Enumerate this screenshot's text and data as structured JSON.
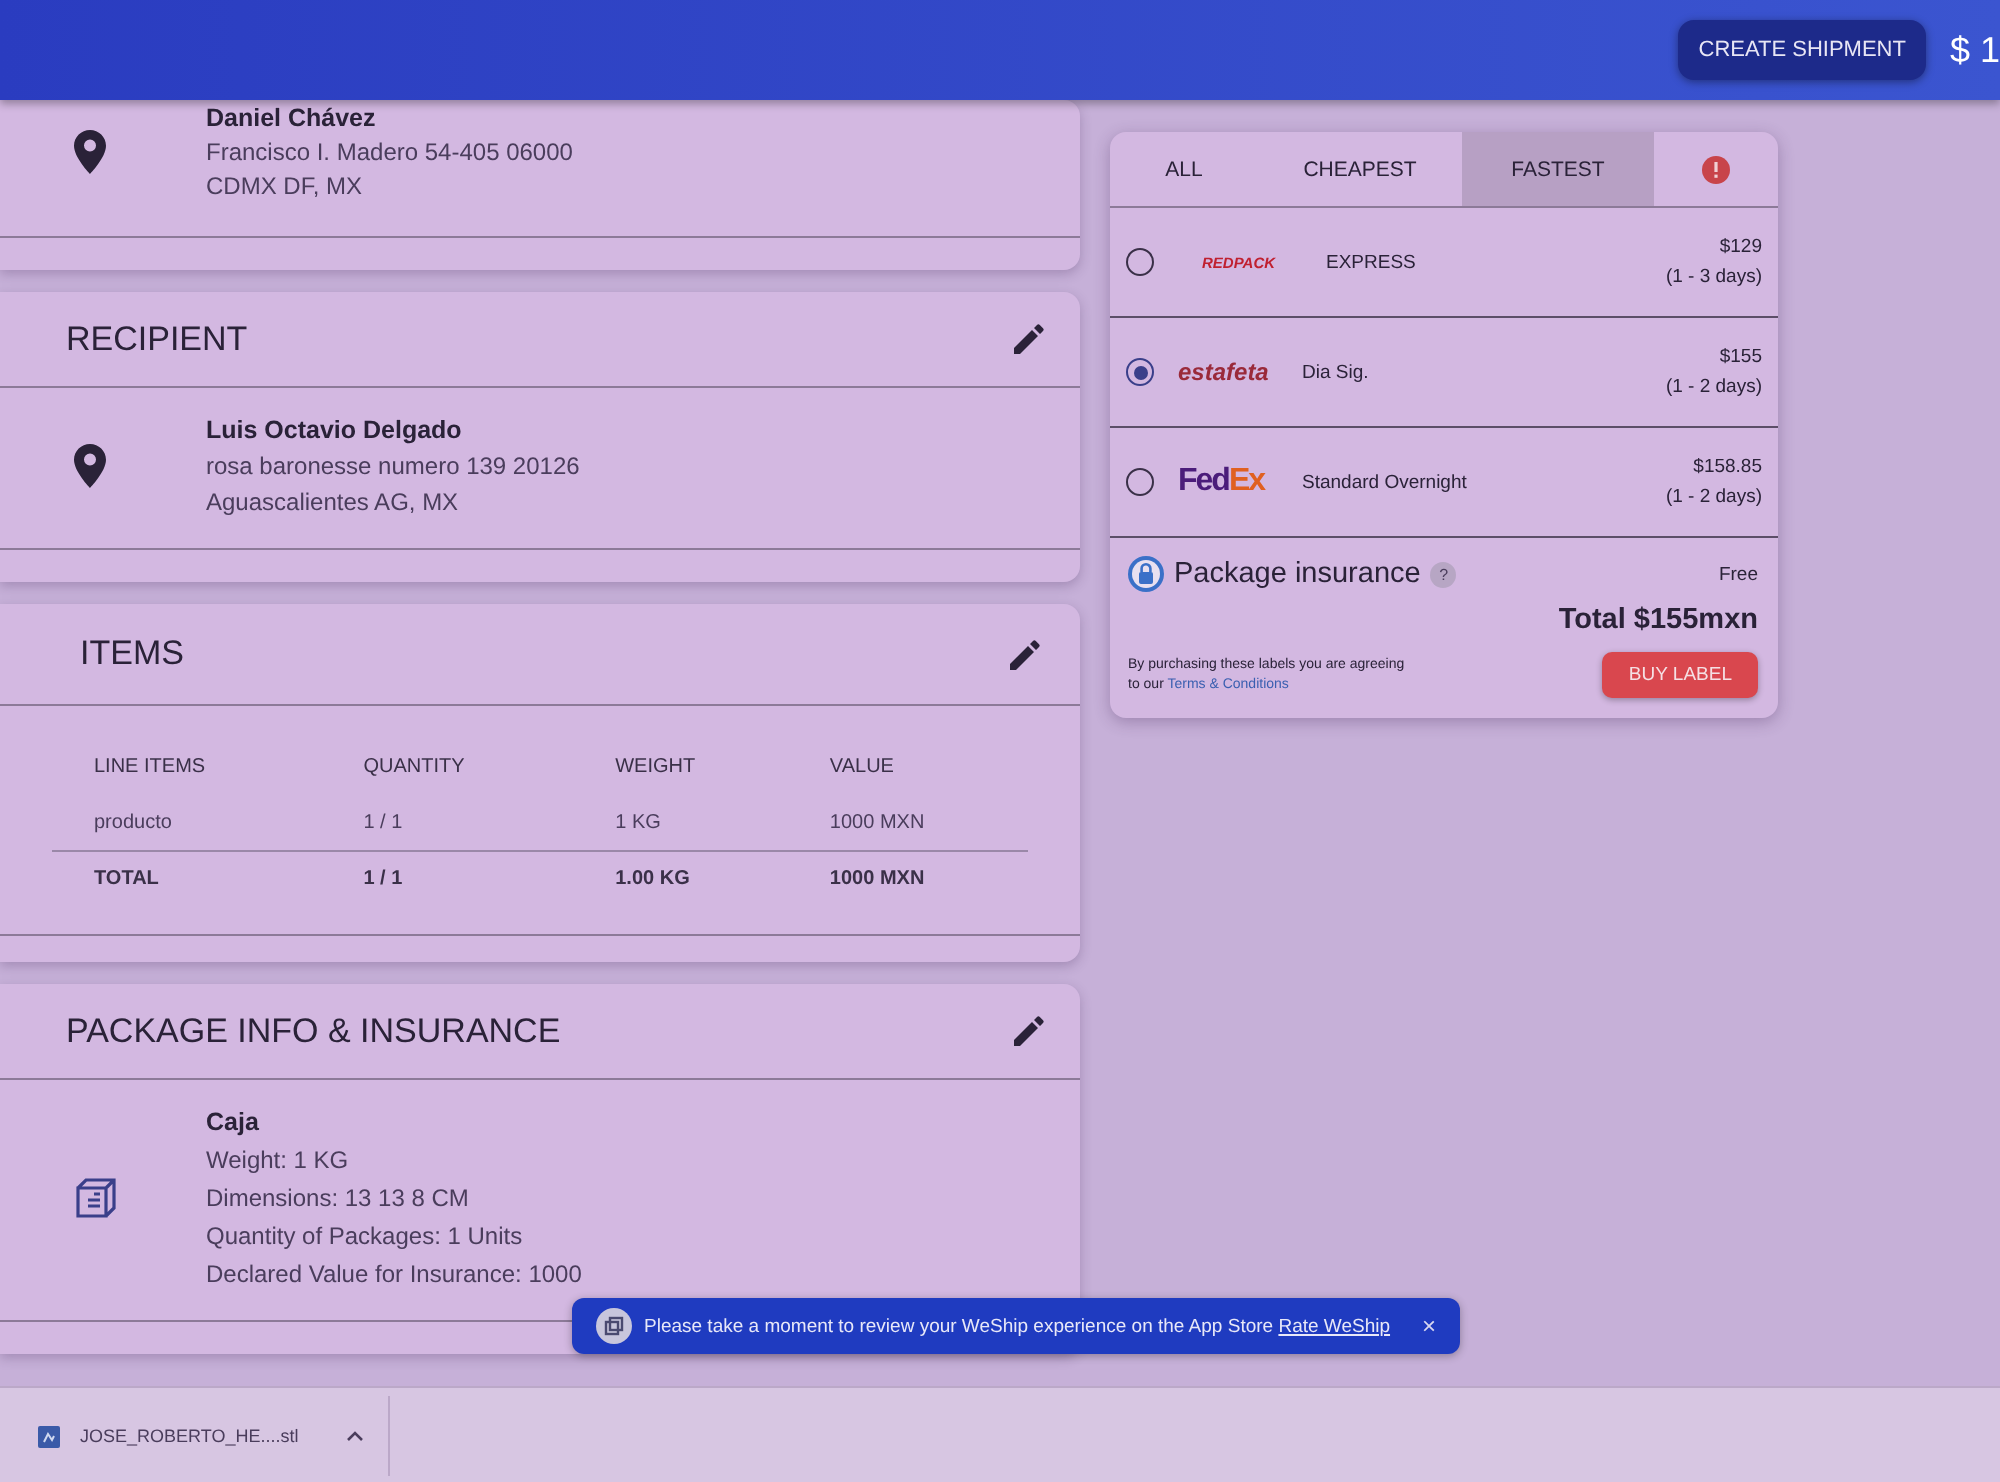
{
  "header": {
    "create_button": "CREATE SHIPMENT",
    "balance": "$ 1"
  },
  "sender": {
    "name": "Daniel Chávez",
    "lines": [
      "Francisco I. Madero 54-405 06000",
      "CDMX DF, MX"
    ]
  },
  "recipient": {
    "title": "RECIPIENT",
    "name": "Luis Octavio Delgado",
    "lines": [
      "rosa baronesse numero 139 20126",
      "Aguascalientes AG, MX"
    ]
  },
  "items": {
    "title": "ITEMS",
    "columns": [
      "LINE ITEMS",
      "QUANTITY",
      "WEIGHT",
      "VALUE"
    ],
    "rows": [
      {
        "kind": "item",
        "cells": [
          "producto",
          "1 / 1",
          "1 KG",
          "1000 MXN"
        ]
      },
      {
        "kind": "total",
        "cells": [
          "TOTAL",
          "1 / 1",
          "1.00 KG",
          "1000 MXN"
        ]
      }
    ]
  },
  "package": {
    "title": "PACKAGE INFO & INSURANCE",
    "name": "Caja",
    "lines": [
      "Weight: 1 KG",
      "Dimensions: 13 13 8 CM",
      "Quantity of Packages: 1 Units",
      "Declared Value for Insurance: 1000"
    ]
  },
  "rates": {
    "tabs": [
      {
        "kind": "text",
        "label": "ALL",
        "selected": false
      },
      {
        "kind": "text",
        "label": "CHEAPEST",
        "selected": false
      },
      {
        "kind": "text",
        "label": "FASTEST",
        "selected": true
      },
      {
        "kind": "alert",
        "selected": false
      }
    ],
    "options": [
      {
        "kind": "redpack",
        "logo": [
          "REDPACK"
        ],
        "service": "EXPRESS",
        "price": "$129",
        "days": "(1 - 3 days)",
        "selected": false
      },
      {
        "kind": "estafeta",
        "logo": [
          "estafeta"
        ],
        "service": "Dia Sig.",
        "price": "$155",
        "days": "(1 - 2 days)",
        "selected": true
      },
      {
        "kind": "fedex",
        "logo": [
          "Fed",
          "Ex"
        ],
        "service": "Standard Overnight",
        "price": "$158.85",
        "days": "(1 - 2 days)",
        "selected": false
      }
    ],
    "insurance": {
      "label": "Package insurance",
      "help": "?",
      "price": "Free"
    },
    "total": "Total $155mxn",
    "disclaimer": "By purchasing these labels you are agreeing to our",
    "terms_link": "Terms & Conditions",
    "buy_button": "BUY LABEL"
  },
  "toast": {
    "text": "Please take a moment to review your WeShip experience on the App Store",
    "link": "Rate WeShip",
    "close": "×"
  },
  "download": {
    "filename": "JOSE_ROBERTO_HE....stl"
  }
}
